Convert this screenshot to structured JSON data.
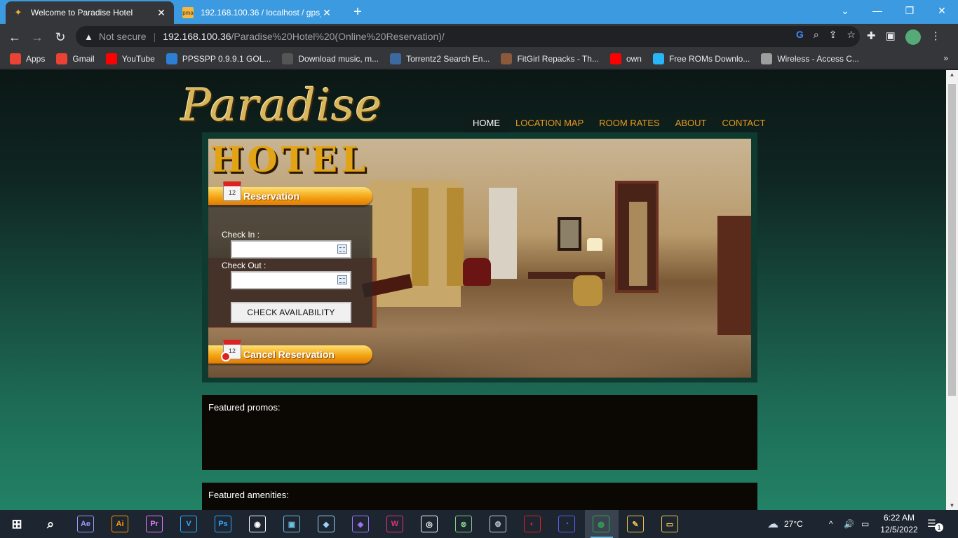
{
  "browser": {
    "tabs": [
      {
        "title": "Welcome to Paradise Hotel",
        "active": true,
        "icon": "paradise-favicon"
      },
      {
        "title": "192.168.100.36 / localhost / gps_",
        "active": false,
        "icon": "phpmyadmin-favicon"
      }
    ],
    "new_tab": "+",
    "window_controls": {
      "minimize": "—",
      "restore": "❐",
      "close": "✕",
      "tab_search": "⌄"
    },
    "nav": {
      "back": "←",
      "forward": "→",
      "reload": "↻"
    },
    "address": {
      "security": "Not secure",
      "host": "192.168.100.36",
      "path": "/Paradise%20Hotel%20(Online%20Reservation)/"
    },
    "bookmarks": [
      {
        "label": "Apps",
        "icon": "apps-grid-icon",
        "color": "#ea4335"
      },
      {
        "label": "Gmail",
        "icon": "gmail-icon",
        "color": "#ea4335"
      },
      {
        "label": "YouTube",
        "icon": "youtube-icon",
        "color": "#ff0000"
      },
      {
        "label": "PPSSPP 0.9.9.1 GOL...",
        "icon": "ppsspp-icon",
        "color": "#2d7fd3"
      },
      {
        "label": "Download music, m...",
        "icon": "monitor-icon",
        "color": "#555555"
      },
      {
        "label": "Torrentz2 Search En...",
        "icon": "torrentz-icon",
        "color": "#3b6aa0"
      },
      {
        "label": "FitGirl Repacks - Th...",
        "icon": "fitgirl-icon",
        "color": "#8a5a3a"
      },
      {
        "label": "own",
        "icon": "youtube-icon",
        "color": "#ff0000"
      },
      {
        "label": "Free ROMs Downlo...",
        "icon": "pacman-ghost-icon",
        "color": "#29b6f6"
      },
      {
        "label": "Wireless - Access C...",
        "icon": "wireless-icon",
        "color": "#9e9e9e"
      }
    ],
    "bookmarks_more": "»"
  },
  "site": {
    "logo": {
      "script": "Paradise",
      "word": "HOTEL"
    },
    "nav": [
      {
        "label": "HOME",
        "active": true
      },
      {
        "label": "LOCATION MAP",
        "active": false
      },
      {
        "label": "ROOM RATES",
        "active": false
      },
      {
        "label": "ABOUT",
        "active": false
      },
      {
        "label": "CONTACT",
        "active": false
      }
    ],
    "reservation": {
      "title": "Reservation",
      "calendar_number": "12",
      "check_in_label": "Check In :",
      "check_in_value": "",
      "check_out_label": "Check Out :",
      "check_out_value": "",
      "button": "CHECK AVAILABILITY"
    },
    "cancel_reservation": {
      "title": "Cancel Reservation",
      "calendar_number": "12"
    },
    "featured_promos": "Featured promos:",
    "featured_amenities": "Featured amenities:"
  },
  "taskbar": {
    "apps": [
      {
        "name": "after-effects-icon",
        "label": "Ae",
        "color": "#9999ff"
      },
      {
        "name": "illustrator-icon",
        "label": "Ai",
        "color": "#ff9a00"
      },
      {
        "name": "premiere-icon",
        "label": "Pr",
        "color": "#ea77ff"
      },
      {
        "name": "visio-icon",
        "label": "V",
        "color": "#31a8ff"
      },
      {
        "name": "photoshop-icon",
        "label": "Ps",
        "color": "#31a8ff"
      },
      {
        "name": "obs-icon",
        "label": "◉",
        "color": "#ffffff"
      },
      {
        "name": "virtualbox-icon",
        "label": "▣",
        "color": "#6ec1e4"
      },
      {
        "name": "hyperv-icon",
        "label": "◆",
        "color": "#9ad2f5"
      },
      {
        "name": "visual-studio-icon",
        "label": "◈",
        "color": "#a974ff"
      },
      {
        "name": "wamp-icon",
        "label": "W",
        "color": "#e8327a"
      },
      {
        "name": "aura-icon",
        "label": "◎",
        "color": "#ffffff"
      },
      {
        "name": "xbox-icon",
        "label": "⊗",
        "color": "#7fd07f"
      },
      {
        "name": "steam-icon",
        "label": "⚙",
        "color": "#c7d5e0"
      },
      {
        "name": "garena-icon",
        "label": "◐",
        "color": "#e02020"
      },
      {
        "name": "discord-icon",
        "label": "◔",
        "color": "#5865f2"
      },
      {
        "name": "chrome-icon",
        "label": "◍",
        "color": "#34a853"
      },
      {
        "name": "paint-icon",
        "label": "✎",
        "color": "#f5c542"
      },
      {
        "name": "file-explorer-icon",
        "label": "▭",
        "color": "#f2c94c"
      }
    ],
    "weather": "27°C",
    "time": "6:22 AM",
    "date": "12/5/2022",
    "notification_count": "1",
    "tray_chevron": "^",
    "volume": "🔊",
    "network": "▭"
  }
}
